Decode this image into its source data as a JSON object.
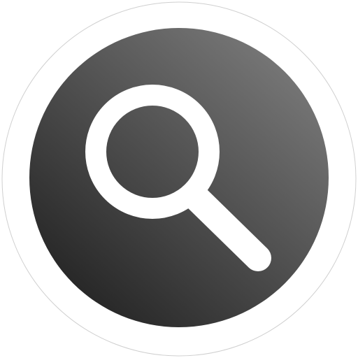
{
  "app_icon": {
    "name": "search-app-icon",
    "glyph": "magnifying-glass",
    "colors": {
      "outer_ring": "#ffffff",
      "outer_ring_stroke": "#cfcfcf",
      "disc_gradient_light": "#777777",
      "disc_gradient_dark": "#262626",
      "glyph": "#ffffff"
    }
  }
}
